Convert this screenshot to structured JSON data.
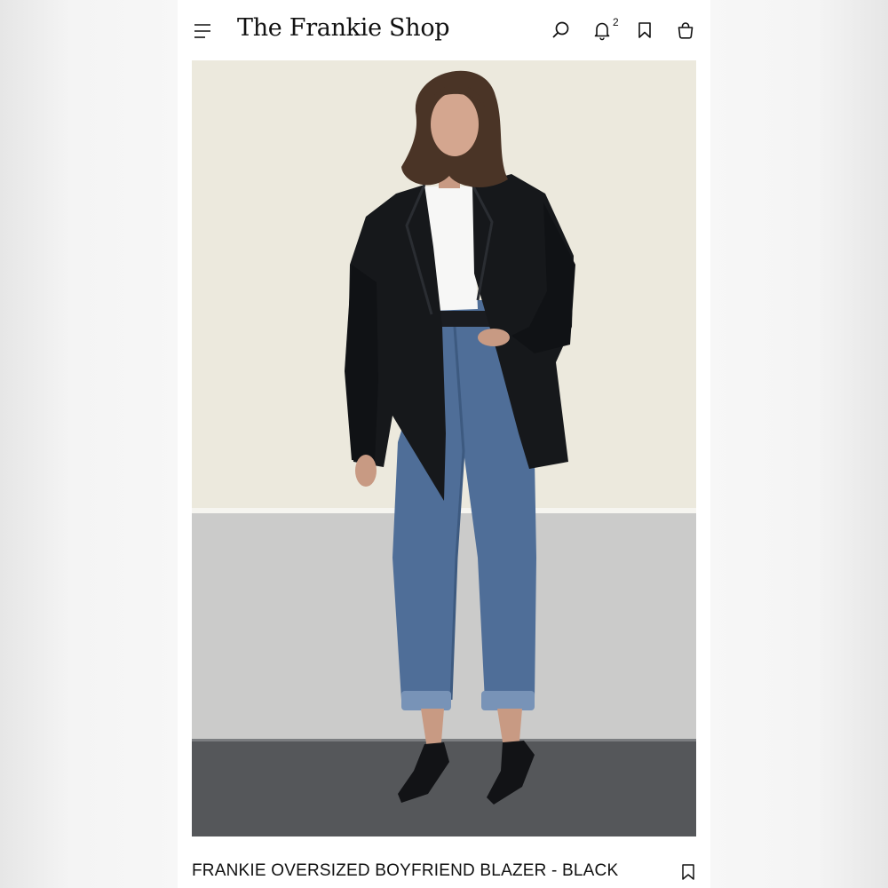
{
  "header": {
    "logo": "The Frankie Shop",
    "notification_count": "2",
    "icons": [
      "menu-icon",
      "search-icon",
      "bell-icon",
      "bookmark-icon",
      "shopping-bag-icon"
    ]
  },
  "product": {
    "name": "FRANKIE OVERSIZED BOYFRIEND BLAZER - BLACK"
  },
  "colors": {
    "wall": "#ece9dd",
    "wall_base": "#cbcbca",
    "pavement": "#55575a",
    "blazer": "#16181b",
    "denim": "#4f6e98"
  }
}
